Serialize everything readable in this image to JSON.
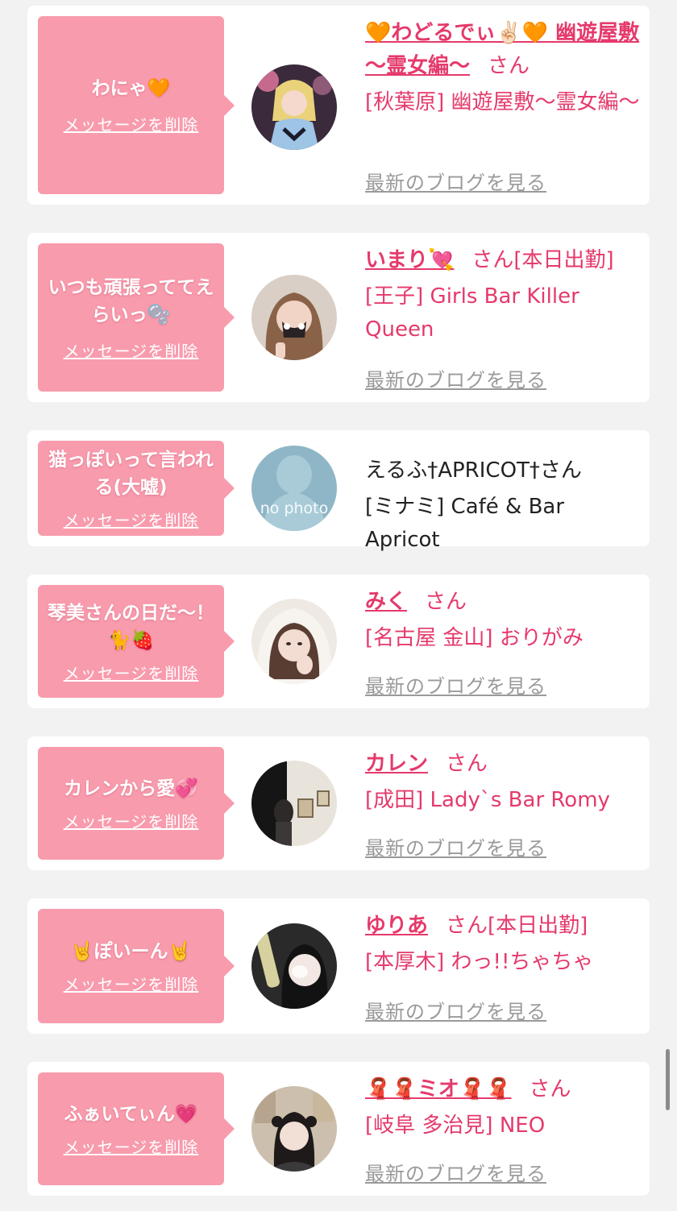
{
  "messages": [
    {
      "message": "わにゃ🧡",
      "delete_label": "メッセージを削除",
      "cast_name": "🧡わどるでぃ✌🏻🧡 幽遊屋敷 〜霊女編〜",
      "honorific": "さん",
      "status": "",
      "shop": "[秋葉原] 幽遊屋敷〜霊女編〜",
      "blog_label": "最新のブログを見る",
      "avatar": "photo-avatar-blonde"
    },
    {
      "message": "いつも頑張っててえらいっ🫧",
      "delete_label": "メッセージを削除",
      "cast_name": "いまり💘",
      "honorific": "さん",
      "status": "[本日出勤]",
      "shop": "[王子] Girls Bar Killer Queen",
      "blog_label": "最新のブログを見る",
      "avatar": "photo-avatar-mask"
    },
    {
      "message": "猫っぽいって言われる(大嘘)",
      "delete_label": "メッセージを削除",
      "cast_name": "えるふ†APRICOT†",
      "honorific": "さん",
      "status": "",
      "shop": "[ミナミ] Café & Bar Apricot",
      "blog_label": "",
      "avatar": "no-photo-avatar",
      "avatar_text": "no photo"
    },
    {
      "message": "琴美さんの日だ〜！🐈🍓",
      "delete_label": "メッセージを削除",
      "cast_name": "みく",
      "honorific": "さん",
      "status": "",
      "shop": "[名古屋 金山] おりがみ",
      "blog_label": "最新のブログを見る",
      "avatar": "photo-avatar-hood"
    },
    {
      "message": "カレンから愛💞",
      "delete_label": "メッセージを削除",
      "cast_name": "カレン",
      "honorific": "さん",
      "status": "",
      "shop": "[成田] Lady`s Bar Romy",
      "blog_label": "最新のブログを見る",
      "avatar": "photo-avatar-gallery"
    },
    {
      "message": "🤘ぽいーん🤘",
      "delete_label": "メッセージを削除",
      "cast_name": "ゆりあ",
      "honorific": "さん",
      "status": "[本日出勤]",
      "shop": "[本厚木] わっ!!ちゃちゃ",
      "blog_label": "最新のブログを見る",
      "avatar": "photo-avatar-bottle"
    },
    {
      "message": "ふぁいてぃん💗",
      "delete_label": "メッセージを削除",
      "cast_name": "🧣🧣ミオ🧣🧣",
      "honorific": "さん",
      "status": "",
      "shop": "[岐阜 多治見] NEO",
      "blog_label": "最新のブログを見る",
      "avatar": "photo-avatar-shop"
    }
  ],
  "colors": {
    "bubble": "#f89bad",
    "accent": "#e53a6b",
    "link_gray": "#9a9a9a",
    "background": "#f2f2f2"
  }
}
